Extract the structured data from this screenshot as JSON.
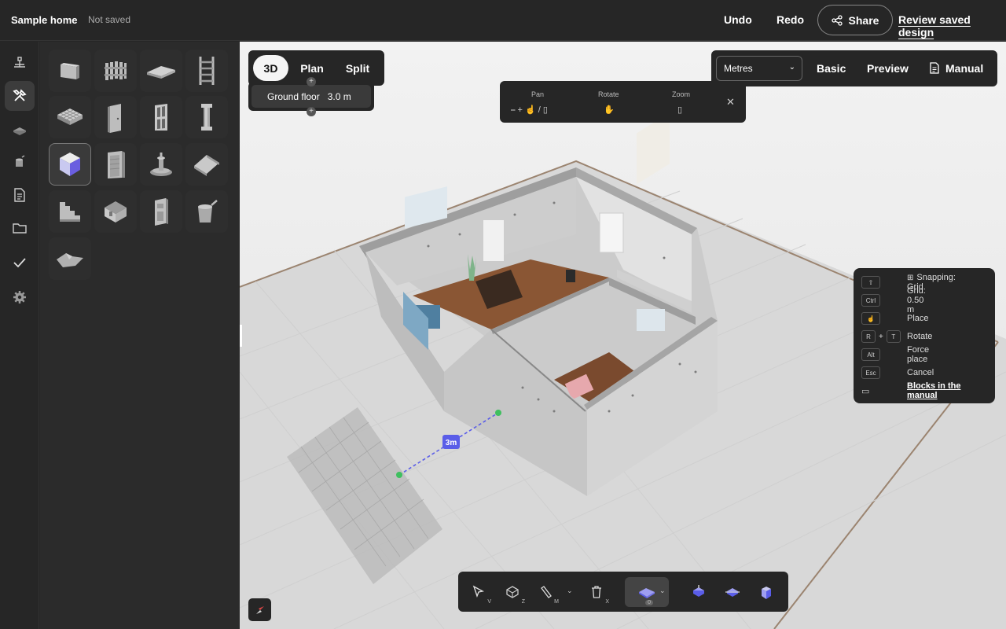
{
  "header": {
    "project_name": "Sample home",
    "save_status": "Not saved",
    "undo": "Undo",
    "redo": "Redo",
    "share": "Share",
    "review": "Review saved design"
  },
  "rail_icons": [
    "hierarchy-icon",
    "build-tools-icon",
    "floor-icon",
    "paint-icon",
    "document-icon",
    "folder-icon",
    "checklist-icon",
    "settings-icon"
  ],
  "palette_icons": [
    "wall-block-icon",
    "fence-icon",
    "slab-icon",
    "ladder-icon",
    "grid-floor-icon",
    "door-icon",
    "window-icon",
    "column-icon",
    "custom-block-icon",
    "cabinet-icon",
    "fountain-icon",
    "roof-icon",
    "stairs-icon",
    "room-icon",
    "appliance-icon",
    "bucket-icon",
    "terrain-icon"
  ],
  "view_tabs": {
    "three_d": "3D",
    "plan": "Plan",
    "split": "Split"
  },
  "floor": {
    "name": "Ground floor",
    "height": "3.0 m"
  },
  "camera_help": {
    "pan": "Pan",
    "rotate": "Rotate",
    "zoom": "Zoom"
  },
  "units": {
    "selected": "Metres"
  },
  "top_right": {
    "basic": "Basic",
    "preview": "Preview",
    "manual": "Manual"
  },
  "shortcuts": [
    {
      "keys": [
        "⇧"
      ],
      "label": "Snapping: Grid"
    },
    {
      "keys": [
        "Ctrl"
      ],
      "label": "Grid: 0.50 m"
    },
    {
      "keys": [
        "☝"
      ],
      "label": "Place"
    },
    {
      "keys": [
        "R",
        "T"
      ],
      "label": "Rotate"
    },
    {
      "keys": [
        "Alt"
      ],
      "label": "Force place"
    },
    {
      "keys": [
        "Esc"
      ],
      "label": "Cancel"
    },
    {
      "keys": [
        "📖"
      ],
      "label": "Blocks in the manual"
    }
  ],
  "scene": {
    "dimension_label": "3m"
  },
  "toolbar": {
    "select_key": "V",
    "orbit_key": "Z",
    "measure_key": "M",
    "delete_key": "X",
    "block_count": "0"
  },
  "colors": {
    "accent": "#5a5de8",
    "panel": "#262626",
    "floor": "#e8e8e8"
  }
}
